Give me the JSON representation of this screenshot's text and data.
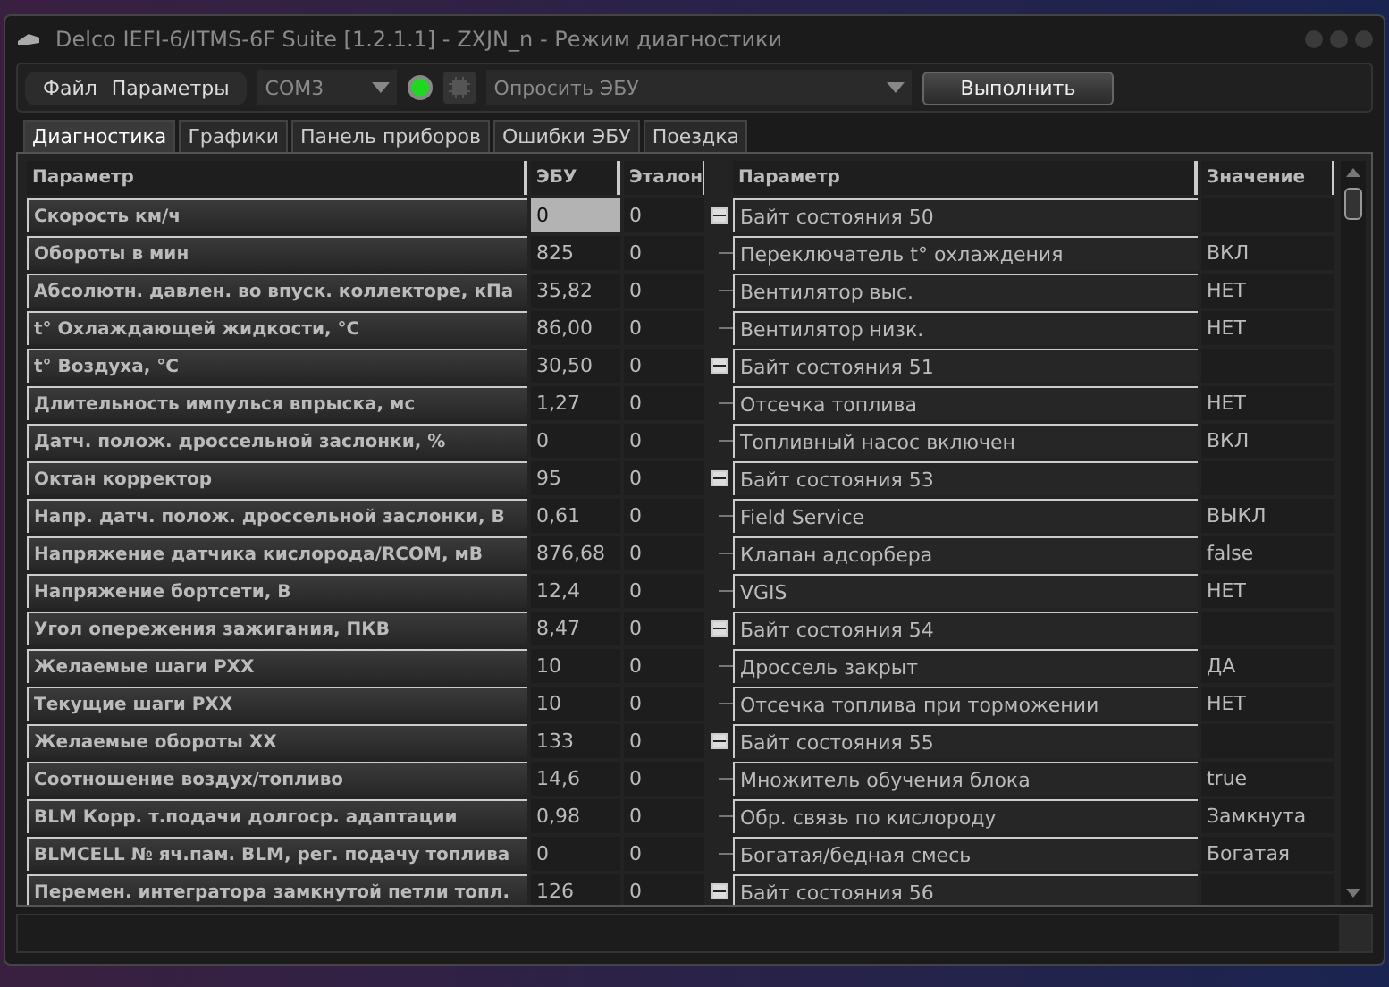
{
  "window": {
    "title": "Delco IEFI-6/ITMS-6F Suite [1.2.1.1] - ZXJN_n - Режим диагностики"
  },
  "menu": [
    "Файл",
    "Параметры"
  ],
  "toolbar": {
    "port": "COM3",
    "connected": true,
    "command": "Опросить ЭБУ",
    "run_button": "Выполнить"
  },
  "tabs": [
    {
      "label": "Диагностика",
      "selected": true
    },
    {
      "label": "Графики",
      "selected": false
    },
    {
      "label": "Панель приборов",
      "selected": false
    },
    {
      "label": "Ошибки ЭБУ",
      "selected": false
    },
    {
      "label": "Поездка",
      "selected": false
    }
  ],
  "left_table": {
    "columns": [
      "Параметр",
      "ЭБУ",
      "Эталон"
    ],
    "rows": [
      {
        "name": "Скорость км/ч",
        "ecu": "0",
        "reference": "0",
        "selected": true
      },
      {
        "name": "Обороты в мин",
        "ecu": "825",
        "reference": "0",
        "selected": false
      },
      {
        "name": "Абсолютн. давлен. во впуск. коллекторе, кПа",
        "ecu": "35,82",
        "reference": "0",
        "selected": false
      },
      {
        "name": "t° Охлаждающей жидкости, °С",
        "ecu": "86,00",
        "reference": "0",
        "selected": false
      },
      {
        "name": "t° Воздуха, °С",
        "ecu": "30,50",
        "reference": "0",
        "selected": false
      },
      {
        "name": "Длительность импулься впрыска, мс",
        "ecu": "1,27",
        "reference": "0",
        "selected": false
      },
      {
        "name": "Датч. полож. дроссельной заслонки, %",
        "ecu": "0",
        "reference": "0",
        "selected": false
      },
      {
        "name": "Октан корректор",
        "ecu": "95",
        "reference": "0",
        "selected": false
      },
      {
        "name": "Напр. датч. полож. дроссельной заслонки, В",
        "ecu": "0,61",
        "reference": "0",
        "selected": false
      },
      {
        "name": "Напряжение датчика кислорода/RCOM, мВ",
        "ecu": "876,68",
        "reference": "0",
        "selected": false
      },
      {
        "name": "Напряжение бортсети, В",
        "ecu": "12,4",
        "reference": "0",
        "selected": false
      },
      {
        "name": "Угол опережения зажигания, ПКВ",
        "ecu": "8,47",
        "reference": "0",
        "selected": false
      },
      {
        "name": "Желаемые шаги РХХ",
        "ecu": "10",
        "reference": "0",
        "selected": false
      },
      {
        "name": "Текущие шаги РХХ",
        "ecu": "10",
        "reference": "0",
        "selected": false
      },
      {
        "name": "Желаемые обороты ХХ",
        "ecu": "133",
        "reference": "0",
        "selected": false
      },
      {
        "name": "Соотношение воздух/топливо",
        "ecu": "14,6",
        "reference": "0",
        "selected": false
      },
      {
        "name": "BLM Корр. т.подачи долгоср. адаптации",
        "ecu": "0,98",
        "reference": "0",
        "selected": false
      },
      {
        "name": "BLMCELL № яч.пам. BLM, рег. подачу топлива",
        "ecu": "0",
        "reference": "0",
        "selected": false
      },
      {
        "name": "Перемен. интегратора замкнутой петли топл.",
        "ecu": "126",
        "reference": "0",
        "selected": false
      }
    ]
  },
  "right_table": {
    "columns": [
      "Параметр",
      "Значение"
    ],
    "groups": [
      {
        "name": "Байт состояния 50",
        "expanded": true,
        "children": [
          {
            "name": "Переключатель t° охлаждения",
            "value": "ВКЛ"
          },
          {
            "name": "Вентилятор выс.",
            "value": "НЕТ"
          },
          {
            "name": "Вентилятор низк.",
            "value": "НЕТ"
          }
        ]
      },
      {
        "name": "Байт состояния 51",
        "expanded": true,
        "children": [
          {
            "name": "Отсечка топлива",
            "value": "НЕТ"
          },
          {
            "name": "Топливный насос включен",
            "value": "ВКЛ"
          }
        ]
      },
      {
        "name": "Байт состояния 53",
        "expanded": true,
        "children": [
          {
            "name": "Field Service",
            "value": "ВЫКЛ"
          },
          {
            "name": "Клапан адсорбера",
            "value": "false"
          },
          {
            "name": "VGIS",
            "value": "НЕТ"
          }
        ]
      },
      {
        "name": "Байт состояния 54",
        "expanded": true,
        "children": [
          {
            "name": "Дроссель закрыт",
            "value": "ДА"
          },
          {
            "name": "Отсечка топлива при торможении",
            "value": "НЕТ"
          }
        ]
      },
      {
        "name": "Байт состояния 55",
        "expanded": true,
        "children": [
          {
            "name": "Множитель обучения блока",
            "value": "true"
          },
          {
            "name": "Обр. связь по кислороду",
            "value": "Замкнута"
          },
          {
            "name": "Богатая/бедная смесь",
            "value": "Богатая"
          }
        ]
      },
      {
        "name": "Байт состояния 56",
        "expanded": true
      }
    ]
  }
}
